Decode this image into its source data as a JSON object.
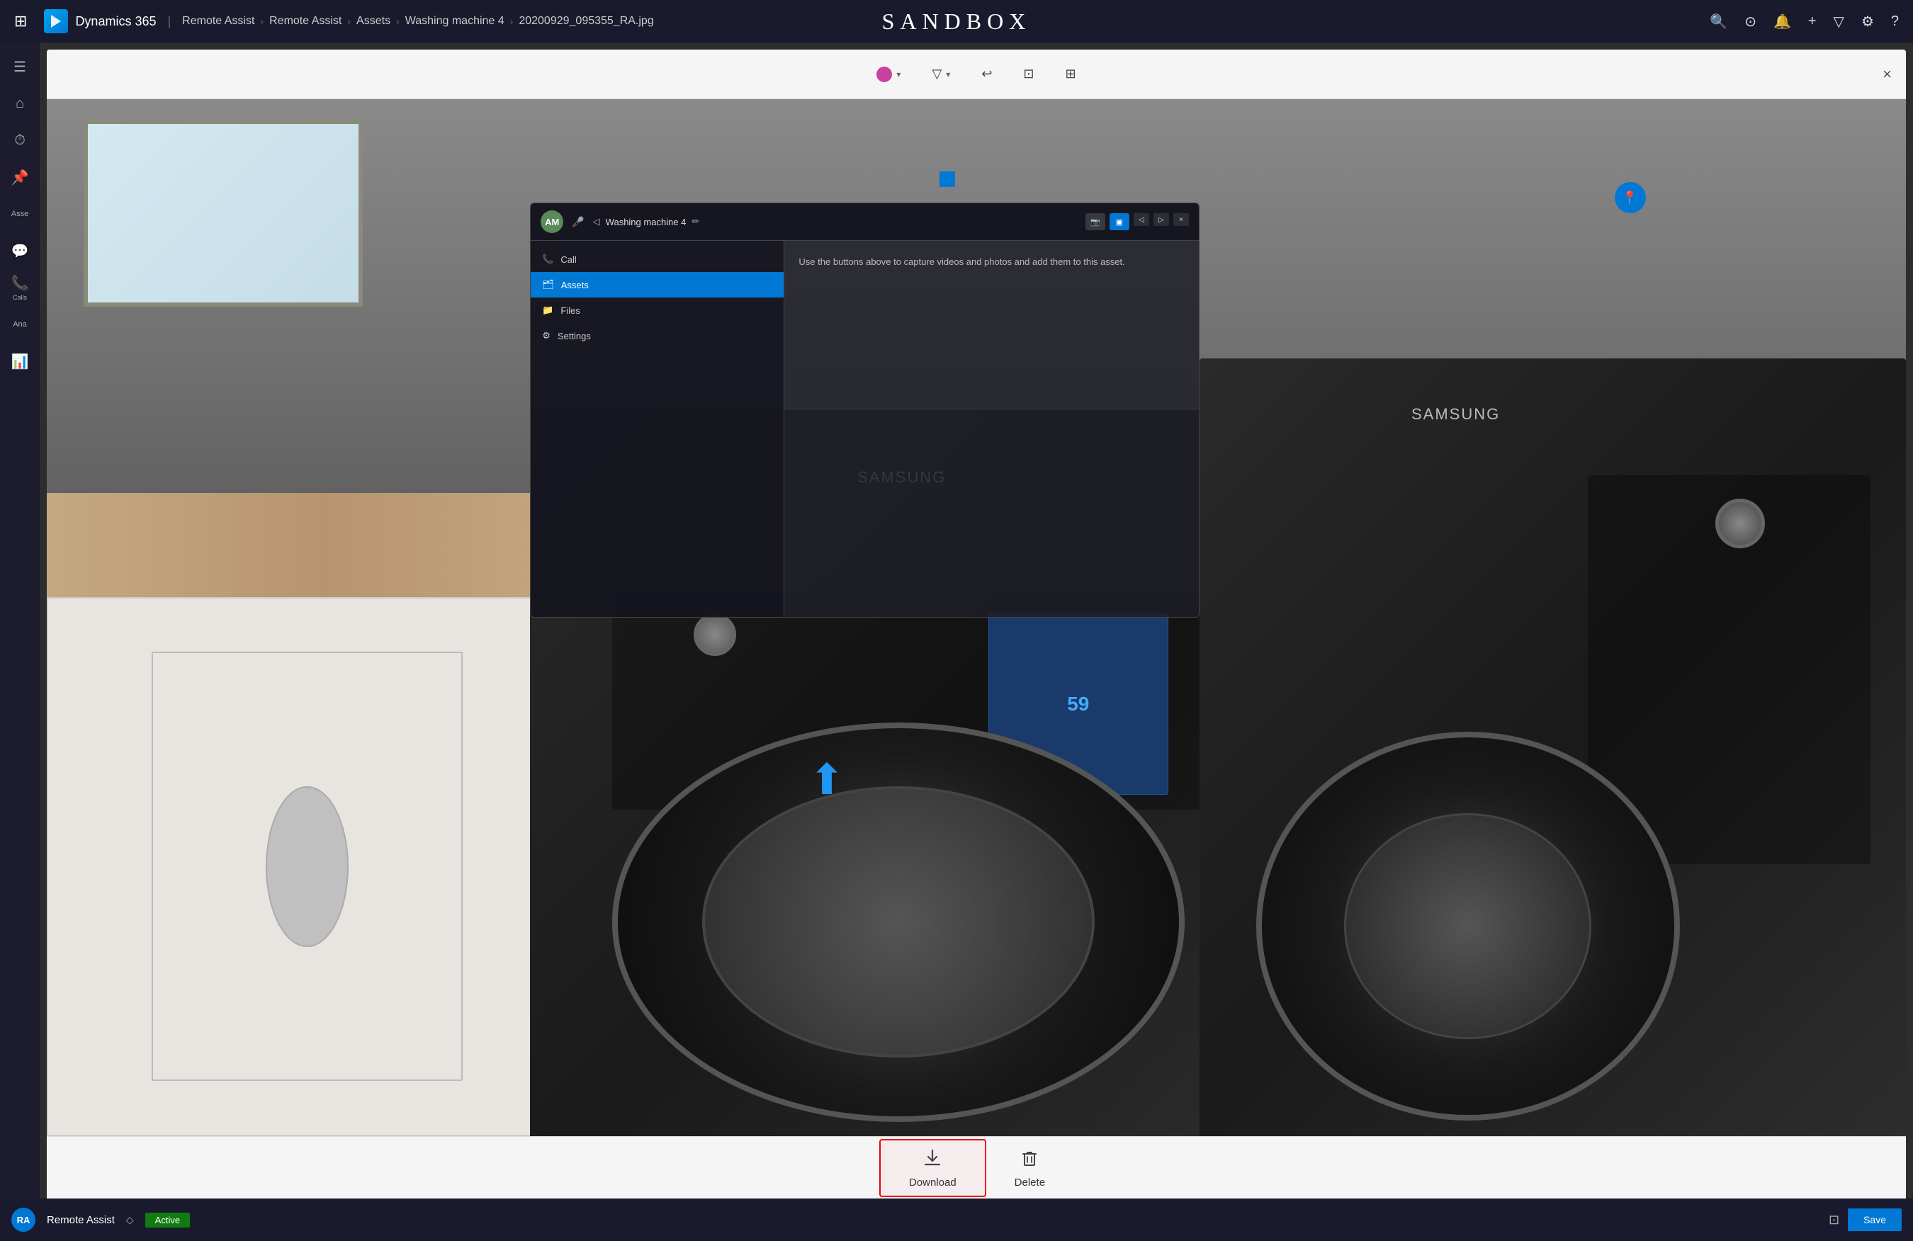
{
  "nav": {
    "apps_icon": "⊞",
    "brand_text": "Dynamics 365",
    "separator": "|",
    "breadcrumb": [
      "Remote Assist",
      "Remote Assist",
      "Assets",
      "Washing machine 4",
      "20200929_095355_RA.jpg"
    ],
    "sandbox_title": "SANDBOX",
    "right_icons": [
      "🔍",
      "⊙",
      "🔔",
      "+",
      "▽",
      "⚙",
      "?"
    ]
  },
  "sidebar": {
    "items": [
      {
        "icon": "☰",
        "label": ""
      },
      {
        "icon": "⌂",
        "label": ""
      },
      {
        "icon": "⏱",
        "label": ""
      },
      {
        "icon": "📌",
        "label": ""
      },
      {
        "icon": "Asse",
        "label": "Assets"
      },
      {
        "icon": "💬",
        "label": ""
      },
      {
        "icon": "📞",
        "label": "Calls"
      },
      {
        "icon": "Ana",
        "label": "Analytics"
      },
      {
        "icon": "📊",
        "label": ""
      }
    ]
  },
  "toolbar": {
    "color_btn_label": "",
    "filter_icon": "▽",
    "undo_icon": "↩",
    "crop_icon": "⊡",
    "frame_icon": "⊞",
    "close_label": "×"
  },
  "hololens": {
    "avatar": "AM",
    "title": "Washing machine 4",
    "edit_icon": "✏",
    "btn_active": "▣",
    "btn_inactive1": "◁",
    "btn_inactive2": "▷",
    "nav_items": [
      {
        "icon": "📞",
        "label": "Call",
        "active": false
      },
      {
        "icon": "🗂",
        "label": "Assets",
        "active": true
      },
      {
        "icon": "📁",
        "label": "Files",
        "active": false
      },
      {
        "icon": "⚙",
        "label": "Settings",
        "active": false
      }
    ],
    "content_text": "Use the buttons above to capture videos and photos and add them to this asset."
  },
  "actions": {
    "download_label": "Download",
    "delete_label": "Delete",
    "download_icon": "⬇",
    "delete_icon": "🗑"
  },
  "bottom_bar": {
    "avatar_initials": "RA",
    "app_name": "Remote Assist",
    "diamond": "◇",
    "status": "Active",
    "save_label": "Save",
    "screen_icon": "⊡"
  }
}
